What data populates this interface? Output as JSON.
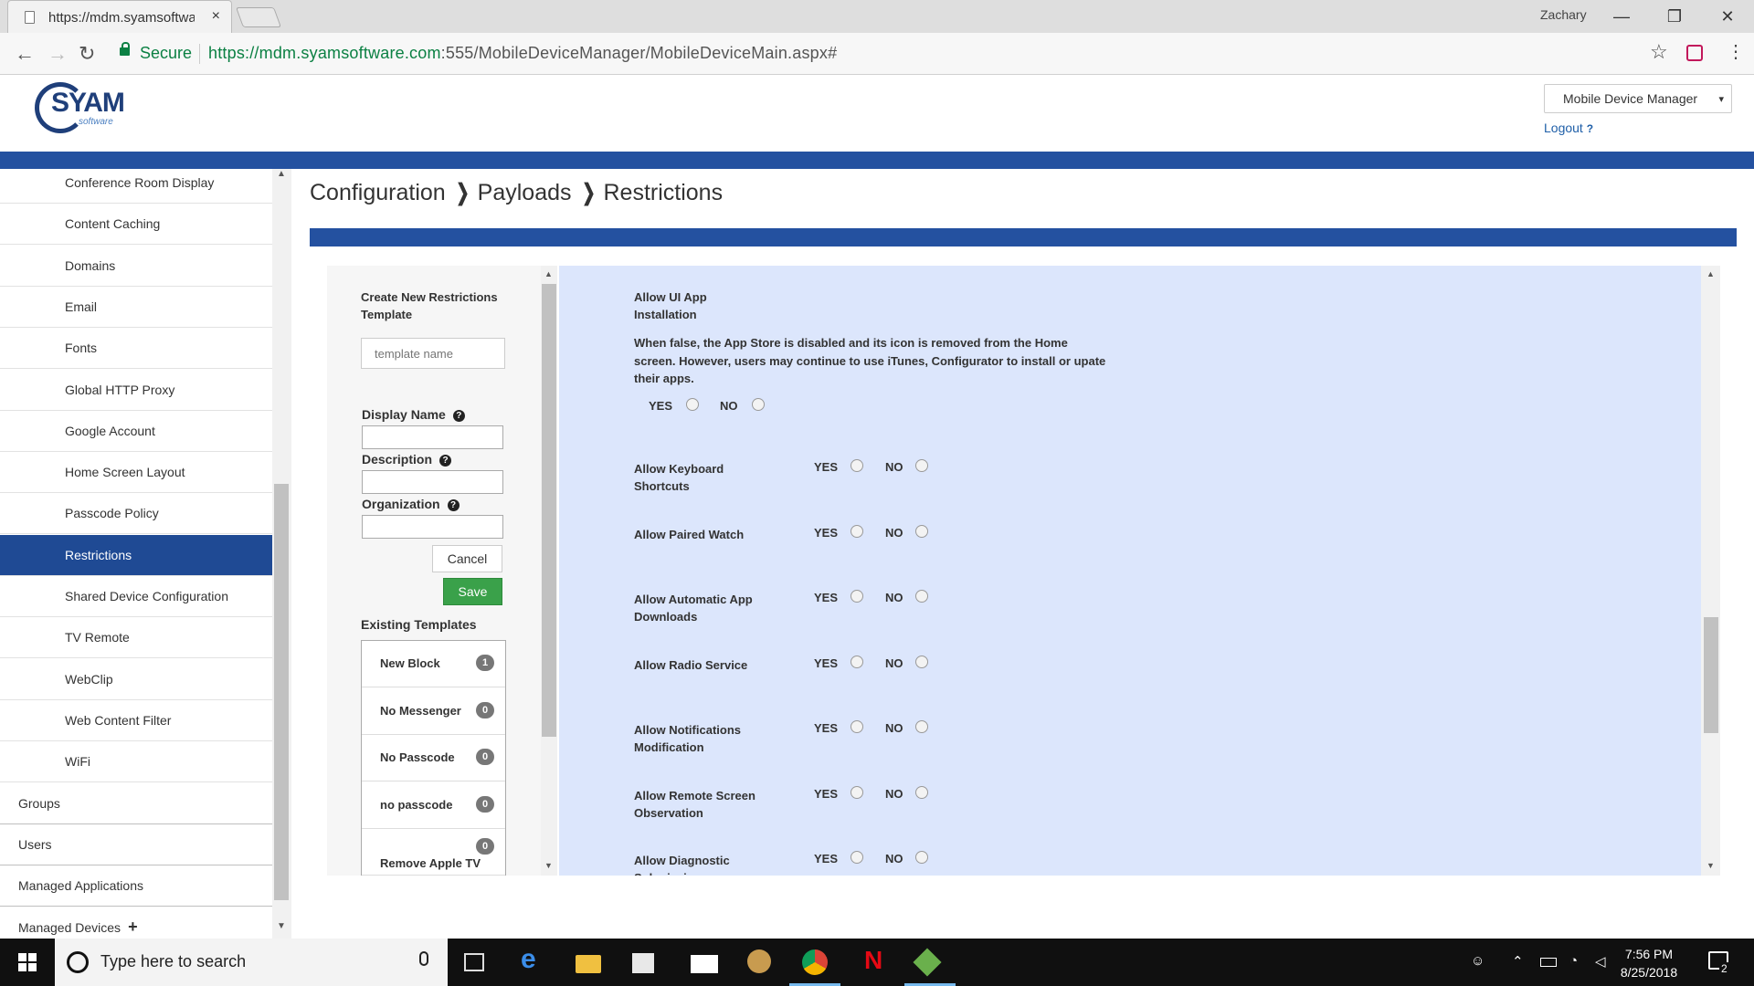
{
  "browser": {
    "tab_title": "https://mdm.syamsoftware.com",
    "tab_close": "×",
    "user": "Zachary",
    "secure_label": "Secure",
    "url_host": "https://mdm.syamsoftware.com",
    "url_path": ":555/MobileDeviceManager/MobileDeviceMain.aspx#",
    "back": "←",
    "forward": "→",
    "reload": "↻",
    "star": "☆",
    "menu": "⋮",
    "minimize": "—",
    "maximize": "❐",
    "close": "✕"
  },
  "header": {
    "logo_text": "SYAM",
    "logo_sub": "software",
    "app_select": "Mobile Device Manager",
    "caret": "▾",
    "logout": "Logout",
    "logout_help": "?"
  },
  "sidebar": {
    "payload_items": [
      {
        "label": "Conference Room Display"
      },
      {
        "label": "Content Caching"
      },
      {
        "label": "Domains"
      },
      {
        "label": "Email"
      },
      {
        "label": "Fonts"
      },
      {
        "label": "Global HTTP Proxy"
      },
      {
        "label": "Google Account"
      },
      {
        "label": "Home Screen Layout"
      },
      {
        "label": "Passcode Policy"
      },
      {
        "label": "Restrictions",
        "active": true
      },
      {
        "label": "Shared Device Configuration"
      },
      {
        "label": "TV Remote"
      },
      {
        "label": "WebClip"
      },
      {
        "label": "Web Content Filter"
      },
      {
        "label": "WiFi"
      }
    ],
    "top_items": [
      {
        "label": "Groups"
      },
      {
        "label": "Users"
      },
      {
        "label": "Managed Applications"
      },
      {
        "label": "Managed Devices",
        "has_plus": true
      }
    ],
    "plus": "+",
    "scroll_up": "▲",
    "scroll_down": "▼"
  },
  "breadcrumb": {
    "items": [
      "Configuration",
      "Payloads",
      "Restrictions"
    ],
    "separator": "❯"
  },
  "left_panel": {
    "create_title": "Create New Restrictions Template",
    "template_placeholder": "template name",
    "display_name_label": "Display Name",
    "description_label": "Description",
    "organization_label": "Organization",
    "help": "?",
    "cancel": "Cancel",
    "save": "Save",
    "existing_title": "Existing Templates",
    "templates": [
      {
        "name": "New Block",
        "count": "1"
      },
      {
        "name": "No Messenger",
        "count": "0"
      },
      {
        "name": "No Passcode",
        "count": "0"
      },
      {
        "name": "no passcode",
        "count": "0"
      },
      {
        "name": "Remove Apple TV",
        "count": "0"
      }
    ]
  },
  "restrictions": {
    "yes": "YES",
    "no": "NO",
    "ui_app": {
      "title": "Allow UI App Installation",
      "description": "When false, the App Store is disabled and its icon is removed from the Home screen. However, users may continue to use iTunes, Configurator to install or upate their apps."
    },
    "items": [
      {
        "title": "Allow Keyboard Shortcuts"
      },
      {
        "title": "Allow Paired Watch"
      },
      {
        "title": "Allow Automatic App Downloads"
      },
      {
        "title": "Allow Radio Service"
      },
      {
        "title": "Allow Notifications Modification"
      },
      {
        "title": "Allow Remote Screen Observation"
      },
      {
        "title": "Allow Diagnostic Submission"
      }
    ]
  },
  "taskbar": {
    "search_placeholder": "Type here to search",
    "time": "7:56 PM",
    "date": "8/25/2018",
    "notification_count": "2"
  }
}
